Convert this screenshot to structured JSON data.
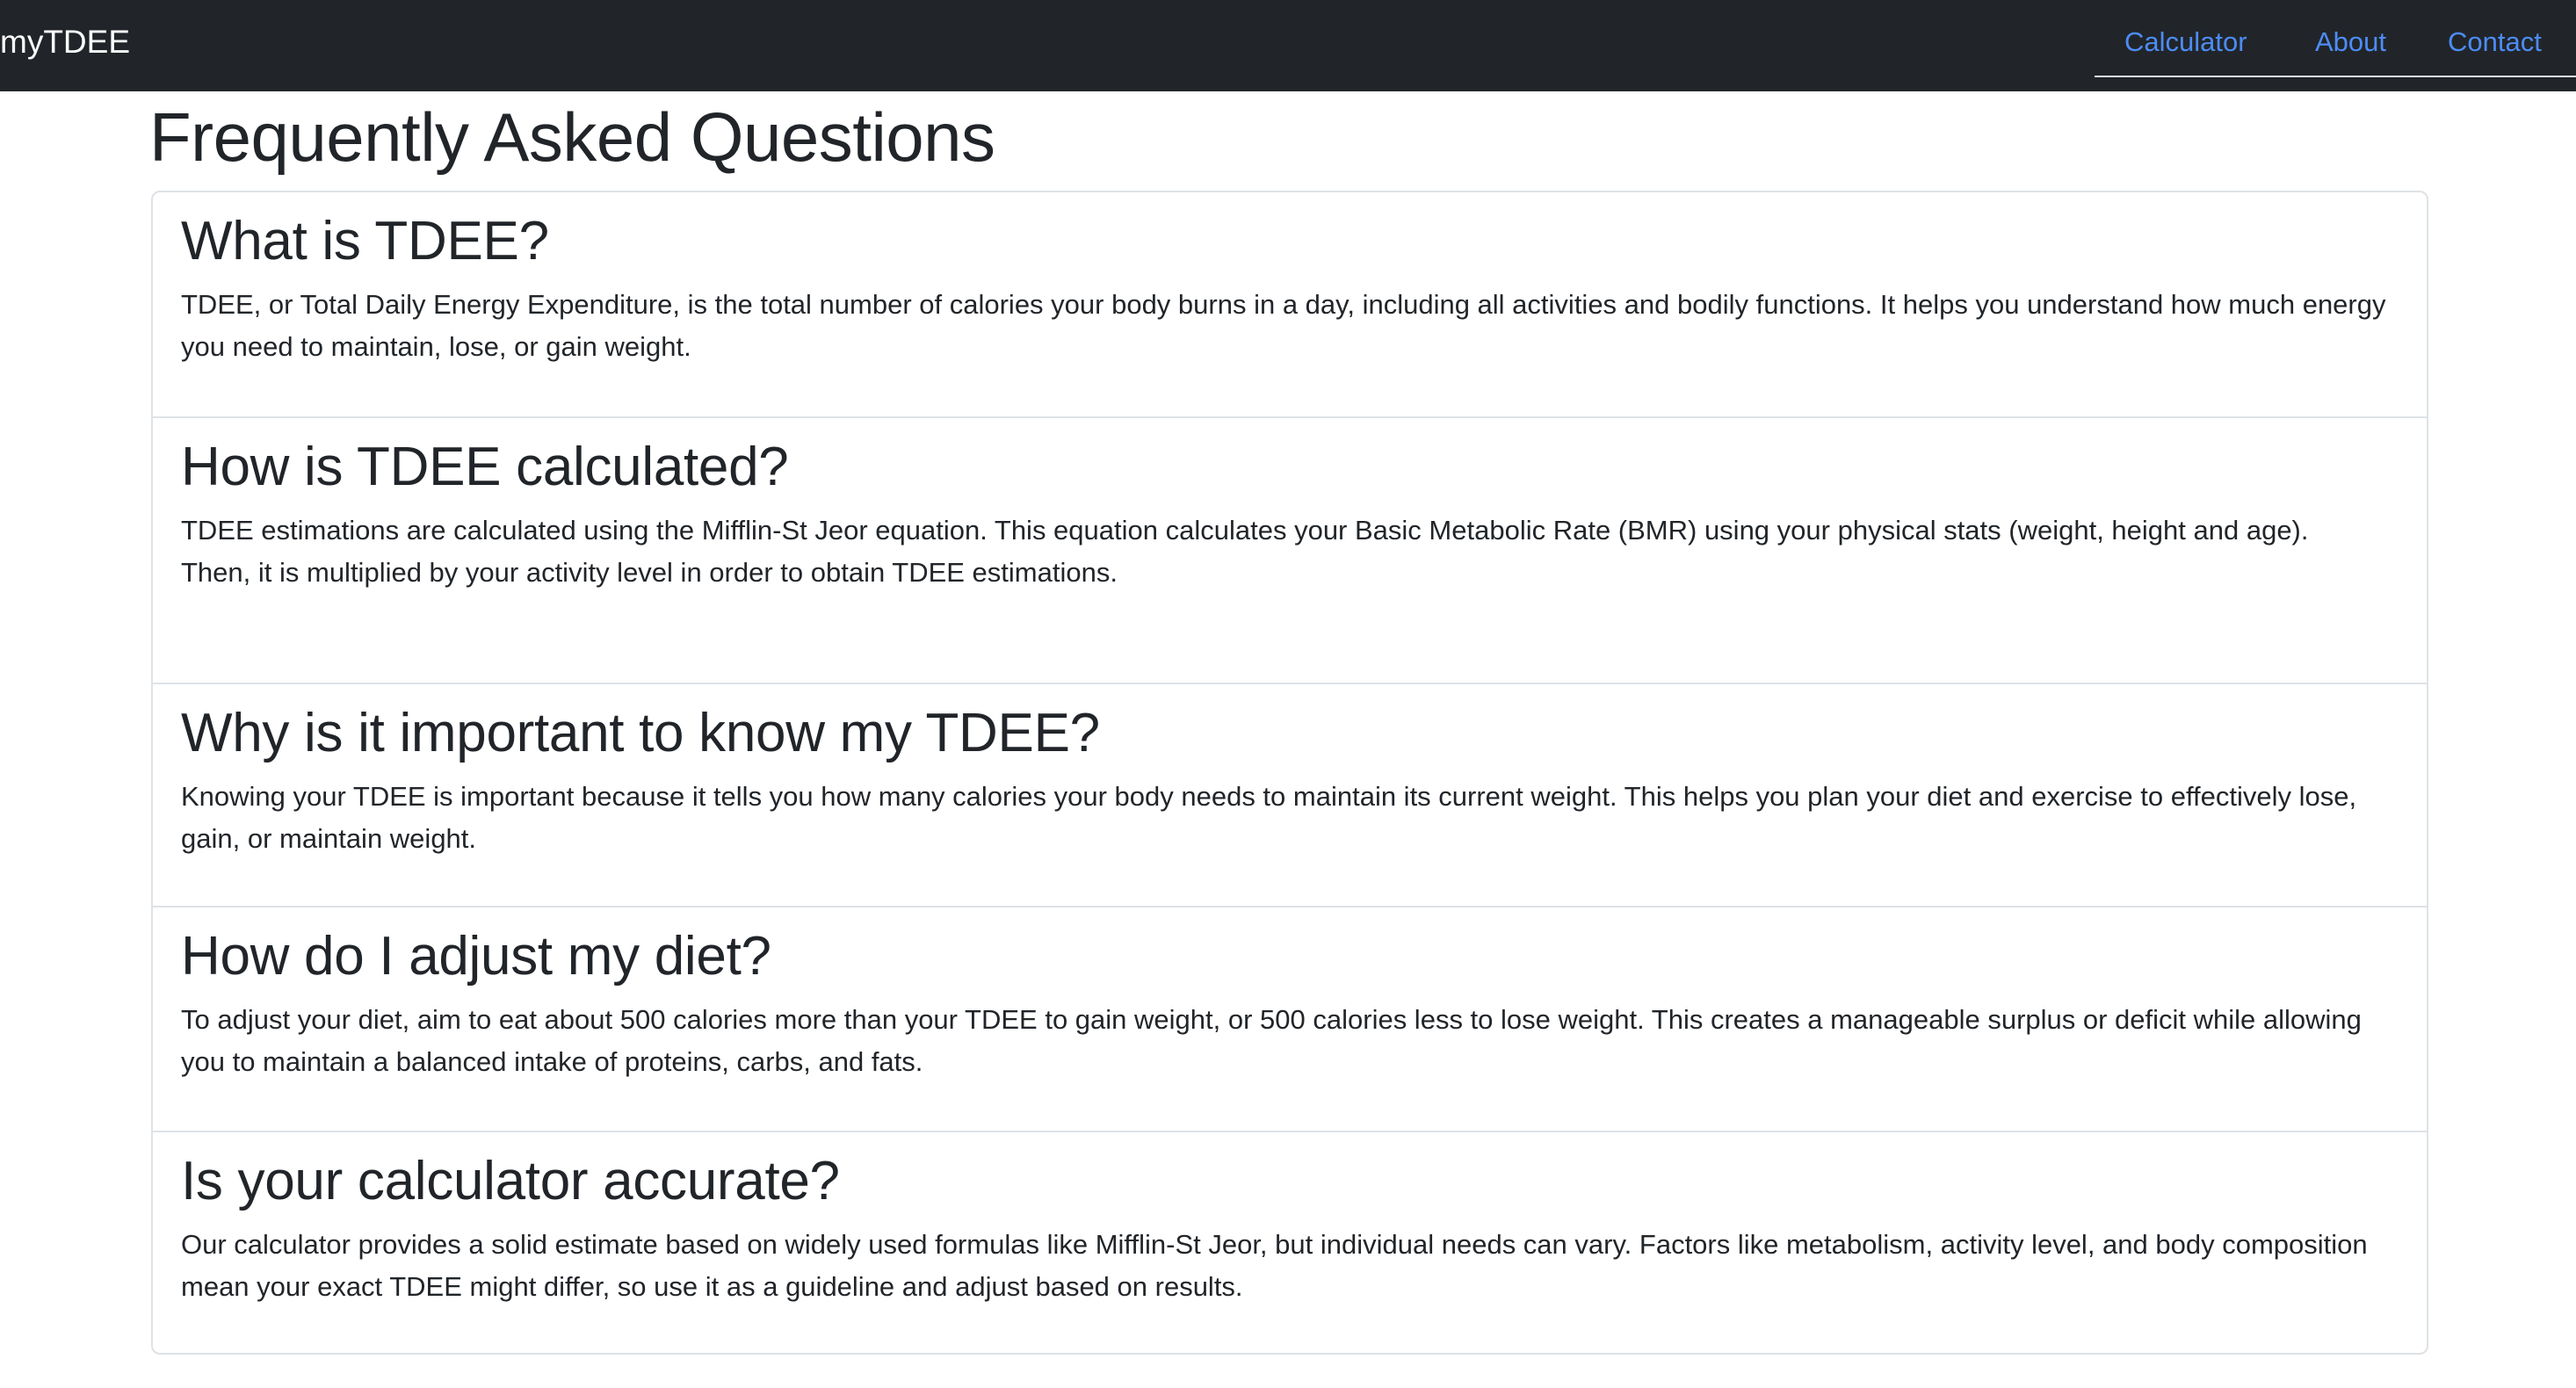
{
  "navbar": {
    "brand": "myTDEE",
    "links": [
      {
        "label": "Calculator"
      },
      {
        "label": "About"
      },
      {
        "label": "Contact"
      }
    ],
    "colors": {
      "background": "#212529",
      "link": "#4d8cf5"
    }
  },
  "main": {
    "title": "Frequently Asked Questions",
    "faqs": [
      {
        "question": "What is TDEE?",
        "answer": [
          "TDEE, or Total Daily Energy Expenditure, is the total number of calories your body burns in a day, including all activities and bodily functions. It helps you understand how much energy you need to maintain, lose, or gain weight."
        ]
      },
      {
        "question": "How is TDEE calculated?",
        "answer": [
          "TDEE estimations are calculated using the Mifflin-St Jeor equation. This equation calculates your Basic Metabolic Rate (BMR) using your physical stats (weight, height and age).",
          "Then, it is multiplied by your activity level in order to obtain TDEE estimations."
        ]
      },
      {
        "question": "Why is it important to know my TDEE?",
        "answer": [
          "Knowing your TDEE is important because it tells you how many calories your body needs to maintain its current weight. This helps you plan your diet and exercise to effectively lose, gain, or maintain weight."
        ]
      },
      {
        "question": "How do I adjust my diet?",
        "answer": [
          "To adjust your diet, aim to eat about 500 calories more than your TDEE to gain weight, or 500 calories less to lose weight. This creates a manageable surplus or deficit while allowing you to maintain a balanced intake of proteins, carbs, and fats."
        ]
      },
      {
        "question": "Is your calculator accurate?",
        "answer": [
          "Our calculator provides a solid estimate based on widely used formulas like Mifflin-St Jeor, but individual needs can vary. Factors like metabolism, activity level, and body composition mean your exact TDEE might differ, so use it as a guideline and adjust based on results."
        ]
      }
    ]
  }
}
